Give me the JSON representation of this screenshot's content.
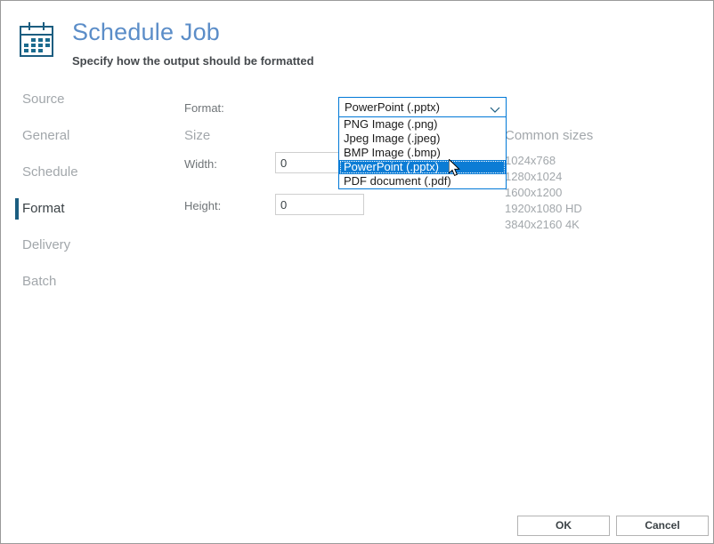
{
  "header": {
    "icon": "calendar-icon",
    "title": "Schedule Job",
    "subtitle": "Specify how the output should be formatted"
  },
  "sidebar": {
    "items": [
      {
        "label": "Source",
        "selected": false
      },
      {
        "label": "General",
        "selected": false
      },
      {
        "label": "Schedule",
        "selected": false
      },
      {
        "label": "Format",
        "selected": true
      },
      {
        "label": "Delivery",
        "selected": false
      },
      {
        "label": "Batch",
        "selected": false
      }
    ],
    "accent_color": "#1b5d80"
  },
  "form": {
    "format_label": "Format:",
    "size_label": "Size",
    "width_label": "Width:",
    "height_label": "Height:",
    "width_value": "0",
    "height_value": "0"
  },
  "format_combo": {
    "selected_value": "PowerPoint (.pptx)",
    "expanded": true,
    "chevron": "chevron-down-icon",
    "border_color": "#0078d7",
    "highlight_color": "#0c7cd5",
    "options": [
      {
        "label": "PNG Image (.png)",
        "selected": false
      },
      {
        "label": "Jpeg Image (.jpeg)",
        "selected": false
      },
      {
        "label": "BMP Image (.bmp)",
        "selected": false
      },
      {
        "label": "PowerPoint (.pptx)",
        "selected": true
      },
      {
        "label": "PDF document (.pdf)",
        "selected": false
      }
    ]
  },
  "common_sizes": {
    "title": "Common sizes",
    "items": [
      "1024x768",
      "1280x1024",
      "1600x1200",
      "1920x1080 HD",
      "3840x2160 4K"
    ]
  },
  "footer": {
    "ok_label": "OK",
    "cancel_label": "Cancel"
  },
  "cursor": {
    "icon": "mouse-pointer-icon"
  }
}
